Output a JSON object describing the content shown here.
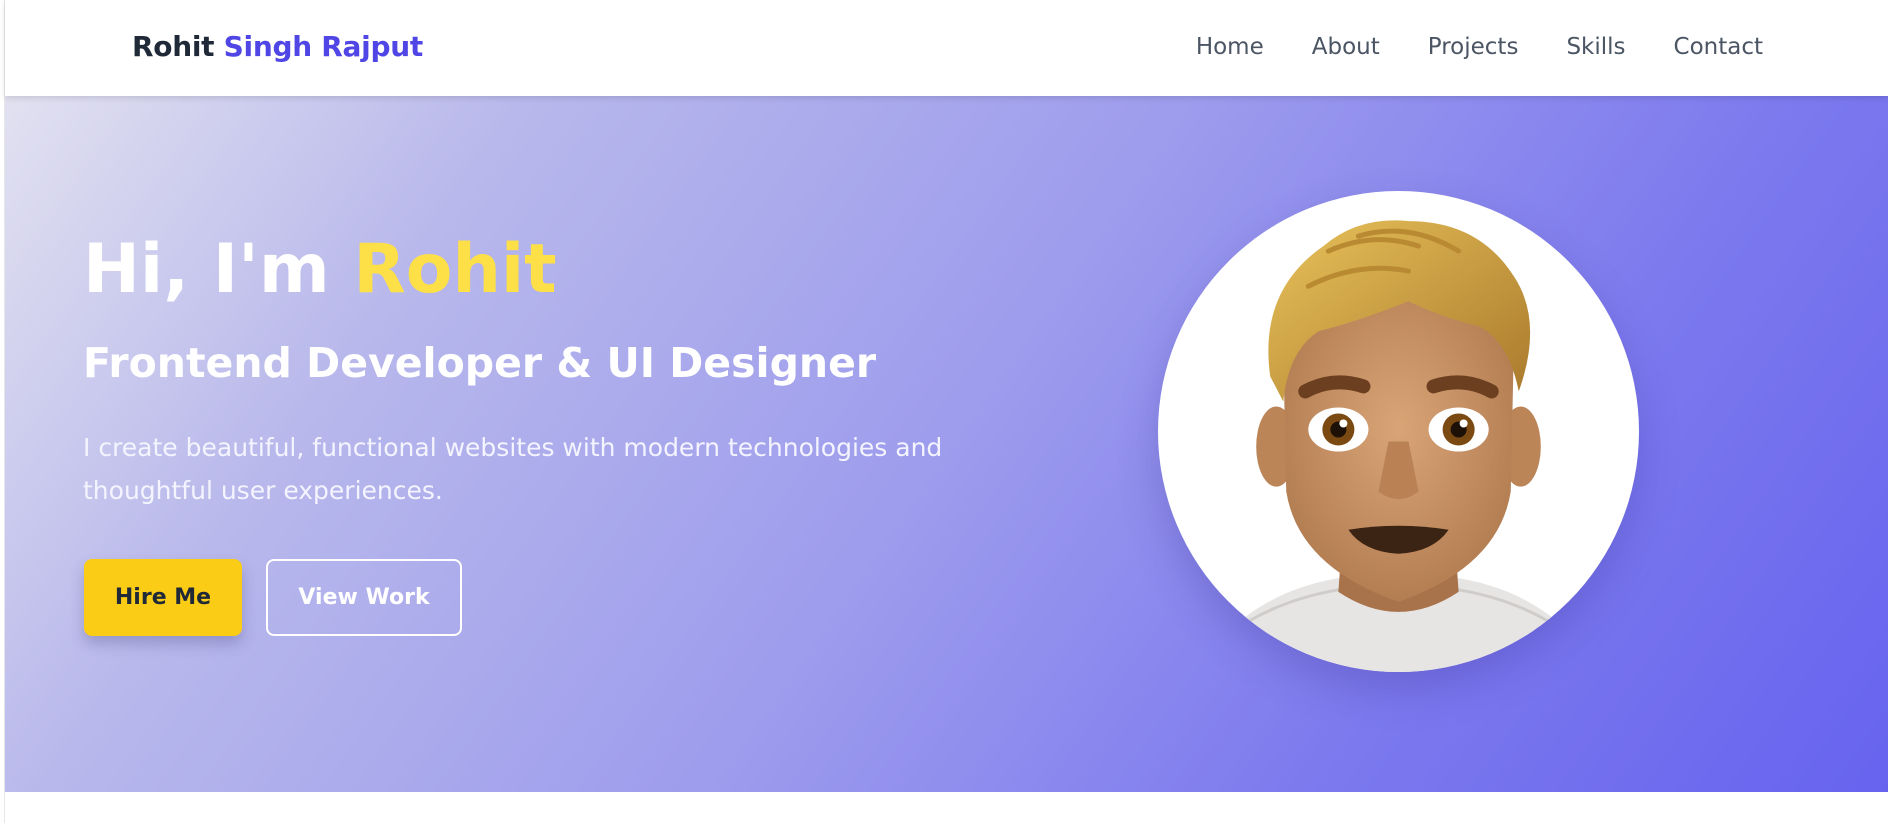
{
  "brand": {
    "first": "Rohit",
    "last": "Singh Rajput"
  },
  "nav": {
    "home": "Home",
    "about": "About",
    "projects": "Projects",
    "skills": "Skills",
    "contact": "Contact"
  },
  "hero": {
    "greeting": "Hi, I'm ",
    "name": "Rohit",
    "subtitle": "Frontend Developer & UI Designer",
    "description": "I create beautiful, functional websites with modern technologies and thoughtful user experiences.",
    "hire_label": "Hire Me",
    "view_label": "View Work",
    "avatar_icon": "person-avatar-icon"
  },
  "colors": {
    "brand_accent": "#4f46e5",
    "highlight": "#fde047",
    "hire_button": "#facc15",
    "gradient_end": "#6763ef"
  }
}
